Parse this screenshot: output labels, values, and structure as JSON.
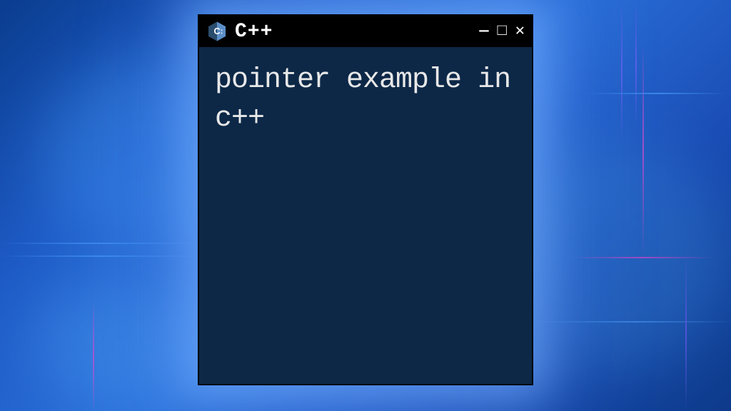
{
  "window": {
    "title": "C++",
    "icon_name": "cpp-hexagon-icon",
    "controls": {
      "minimize": "—",
      "maximize": "□",
      "close": "✕"
    }
  },
  "content": {
    "code": "pointer example in c++"
  },
  "colors": {
    "titlebar_bg": "#000000",
    "content_bg": "#0d2847",
    "text": "#e8e8e8",
    "icon_blue": "#5c8ec7",
    "icon_dark": "#2a4d6e"
  }
}
